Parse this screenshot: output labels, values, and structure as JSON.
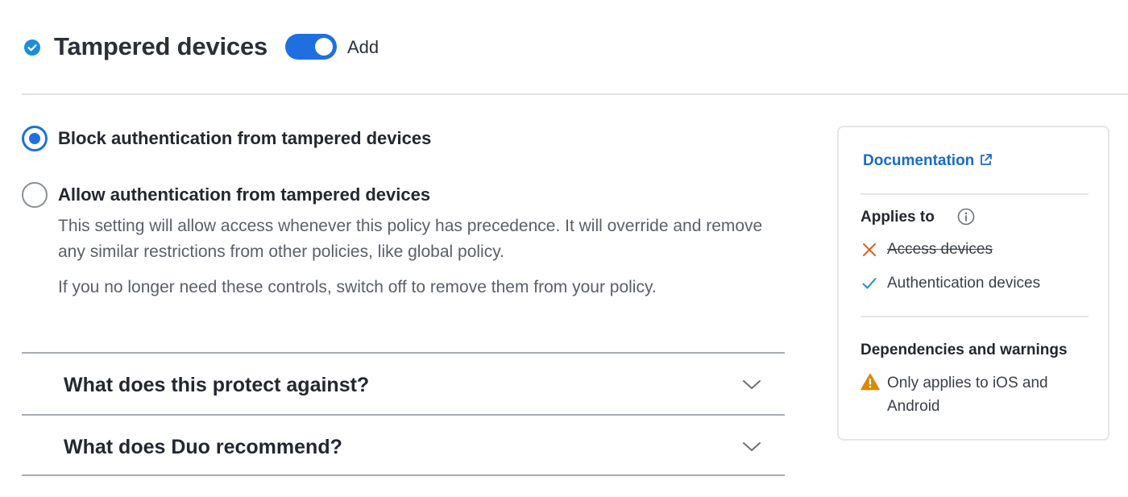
{
  "header": {
    "title": "Tampered devices",
    "toggle_label": "Add",
    "toggle_on": true,
    "accent_color": "#1f6fe0"
  },
  "options": [
    {
      "label": "Block authentication from tampered devices",
      "selected": true
    },
    {
      "label": "Allow authentication from tampered devices",
      "selected": false,
      "description": [
        "This setting will allow access whenever this policy has precedence. It will override and remove any similar restrictions from other policies, like global policy.",
        "If you no longer need these controls, switch off to remove them from your policy."
      ]
    }
  ],
  "accordion": [
    {
      "title": "What does this protect against?",
      "icon": "chevron-down-icon"
    },
    {
      "title": "What does Duo recommend?",
      "icon": "chevron-down-icon"
    }
  ],
  "sidebar": {
    "doc_link": "Documentation",
    "applies_to": {
      "heading": "Applies to",
      "items": [
        {
          "label": "Access devices",
          "applies": false,
          "icon": "x-icon",
          "color": "#e0601f"
        },
        {
          "label": "Authentication devices",
          "applies": true,
          "icon": "check-icon",
          "color": "#1a8fd8"
        }
      ]
    },
    "dependencies": {
      "heading": "Dependencies and warnings",
      "warning": "Only applies to iOS and Android",
      "warning_color": "#d98a00"
    }
  }
}
